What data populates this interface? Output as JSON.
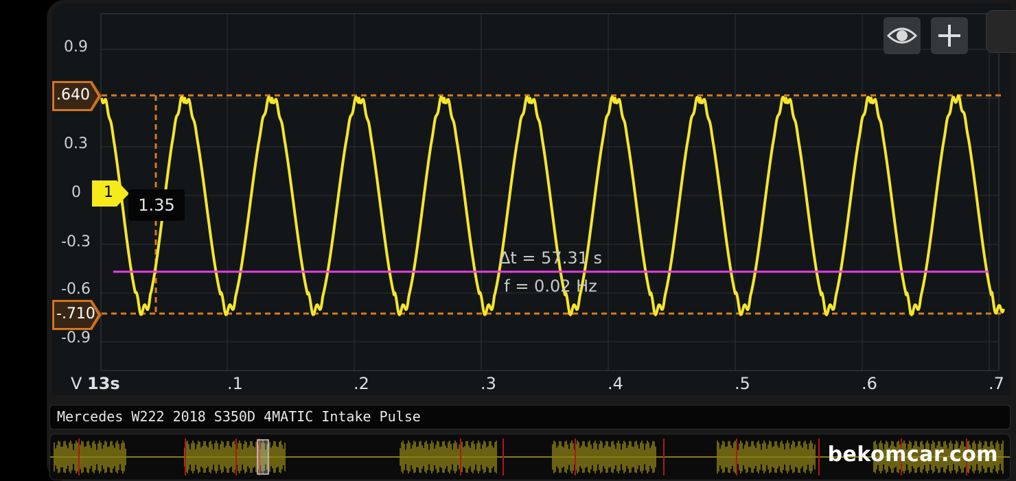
{
  "scope": {
    "y_axis": {
      "unit": "V",
      "ticks": [
        "0.9",
        "0.3",
        "0",
        "-0.3",
        "-0.6",
        "-0.9"
      ]
    },
    "x_axis": {
      "start": "13s",
      "ticks": [
        ".1",
        ".2",
        ".3",
        ".4",
        ".5",
        ".6",
        ".7"
      ]
    },
    "cursor_upper": ".640",
    "cursor_lower": "-.710",
    "channel": "1",
    "tooltip": "1.35",
    "delta_t": "Δt = 57.31 s",
    "frequency": "f = 0.02 Hz",
    "colors": {
      "trace": "#f5e62a",
      "cursor": "#d97a1e",
      "time_marker": "#e43fe6",
      "grid": "#2d3337"
    }
  },
  "toolbar": {
    "eye_icon": "eye-icon",
    "add_icon": "plus-icon"
  },
  "signal_title": "Mercedes W222 2018 S350D 4MATIC Intake Pulse",
  "watermark": "bekomcar.com"
}
